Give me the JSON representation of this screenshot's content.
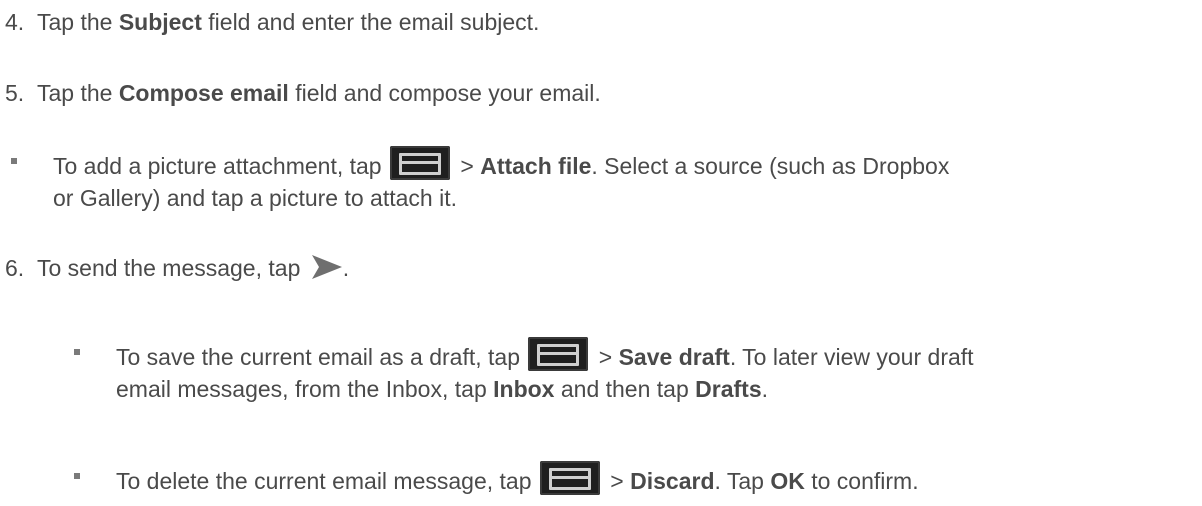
{
  "step4": {
    "number": "4.",
    "pre": "Tap the ",
    "bold": "Subject",
    "post": " field and enter the email subject."
  },
  "step5": {
    "number": "5.",
    "pre": "Tap the ",
    "bold": "Compose email",
    "post": " field and compose your email."
  },
  "bullet_attach": {
    "line1_pre": "To add a picture attachment, tap ",
    "sep": " > ",
    "bold": "Attach file",
    "line1_post": ". Select a source (such as Dropbox",
    "line2": "or Gallery) and tap a picture to attach it."
  },
  "step6": {
    "number": "6.",
    "text": "To send the message, tap ",
    "end": "."
  },
  "bullet_save": {
    "line1_pre": "To save the current email as a draft, tap ",
    "sep": " > ",
    "bold1": "Save draft",
    "line1_post": ". To later view your draft",
    "line2_pre": "email messages, from the Inbox, tap ",
    "bold2": "Inbox",
    "line2_mid": " and then tap ",
    "bold3": "Drafts",
    "line2_end": "."
  },
  "bullet_discard": {
    "pre": "To delete the current email message, tap ",
    "sep": " > ",
    "bold1": "Discard",
    "mid": ". Tap ",
    "bold2": "OK",
    "post": " to confirm."
  },
  "icons": {
    "menu": "menu-icon",
    "send": "send-arrow-icon"
  },
  "colors": {
    "text": "#4a4a4a",
    "icon_bg": "#1f1f1f",
    "icon_fg": "#cfcfcf"
  }
}
